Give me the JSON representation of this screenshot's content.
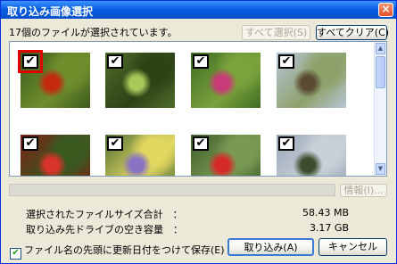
{
  "window": {
    "title": "取り込み画像選択",
    "close_glyph": "×"
  },
  "summary": {
    "text": "17個のファイルが選択されています。"
  },
  "toolbar": {
    "deselect_all_label": "すべて選択(S)",
    "clear_all_label": "すべてクリア(C)"
  },
  "thumbnails": [
    {
      "check": "✔",
      "colors": [
        "#3b5a1e",
        "#c42a10",
        "#6f8e2c"
      ]
    },
    {
      "check": "✔",
      "colors": [
        "#4e6b2a",
        "#a8c85a",
        "#2d4316"
      ]
    },
    {
      "check": "✔",
      "colors": [
        "#3f6a24",
        "#c83a78",
        "#7aa33c"
      ]
    },
    {
      "check": "✔",
      "colors": [
        "#b7c4d8",
        "#5a4a32",
        "#8da26a"
      ]
    },
    {
      "check": "✔",
      "colors": [
        "#7a2015",
        "#d8332a",
        "#3a5a20"
      ]
    },
    {
      "check": "✔",
      "colors": [
        "#4f6e36",
        "#8a73c2",
        "#e2d860"
      ]
    },
    {
      "check": "✔",
      "colors": [
        "#3f5e2a",
        "#d62a2a",
        "#7a9a54"
      ]
    },
    {
      "check": "✔",
      "colors": [
        "#9aa8b8",
        "#3a4c2c",
        "#c8d0d8"
      ]
    }
  ],
  "details_button": {
    "label": "情報(I)..."
  },
  "info": {
    "total_size_label": "選択されたファイルサイズ合計　：",
    "total_size_value": "58.43 MB",
    "free_space_label": "取り込み先ドライブの空き容量　：",
    "free_space_value": "3.17 GB"
  },
  "options": {
    "prefix_date_label": "ファイル名の先頭に更新日付をつけて保存(E)",
    "prefix_date_checked": "✔"
  },
  "actions": {
    "import_label": "取り込み(A)",
    "cancel_label": "キャンセル"
  },
  "scrollbar": {
    "up": "▲",
    "down": "▼"
  }
}
